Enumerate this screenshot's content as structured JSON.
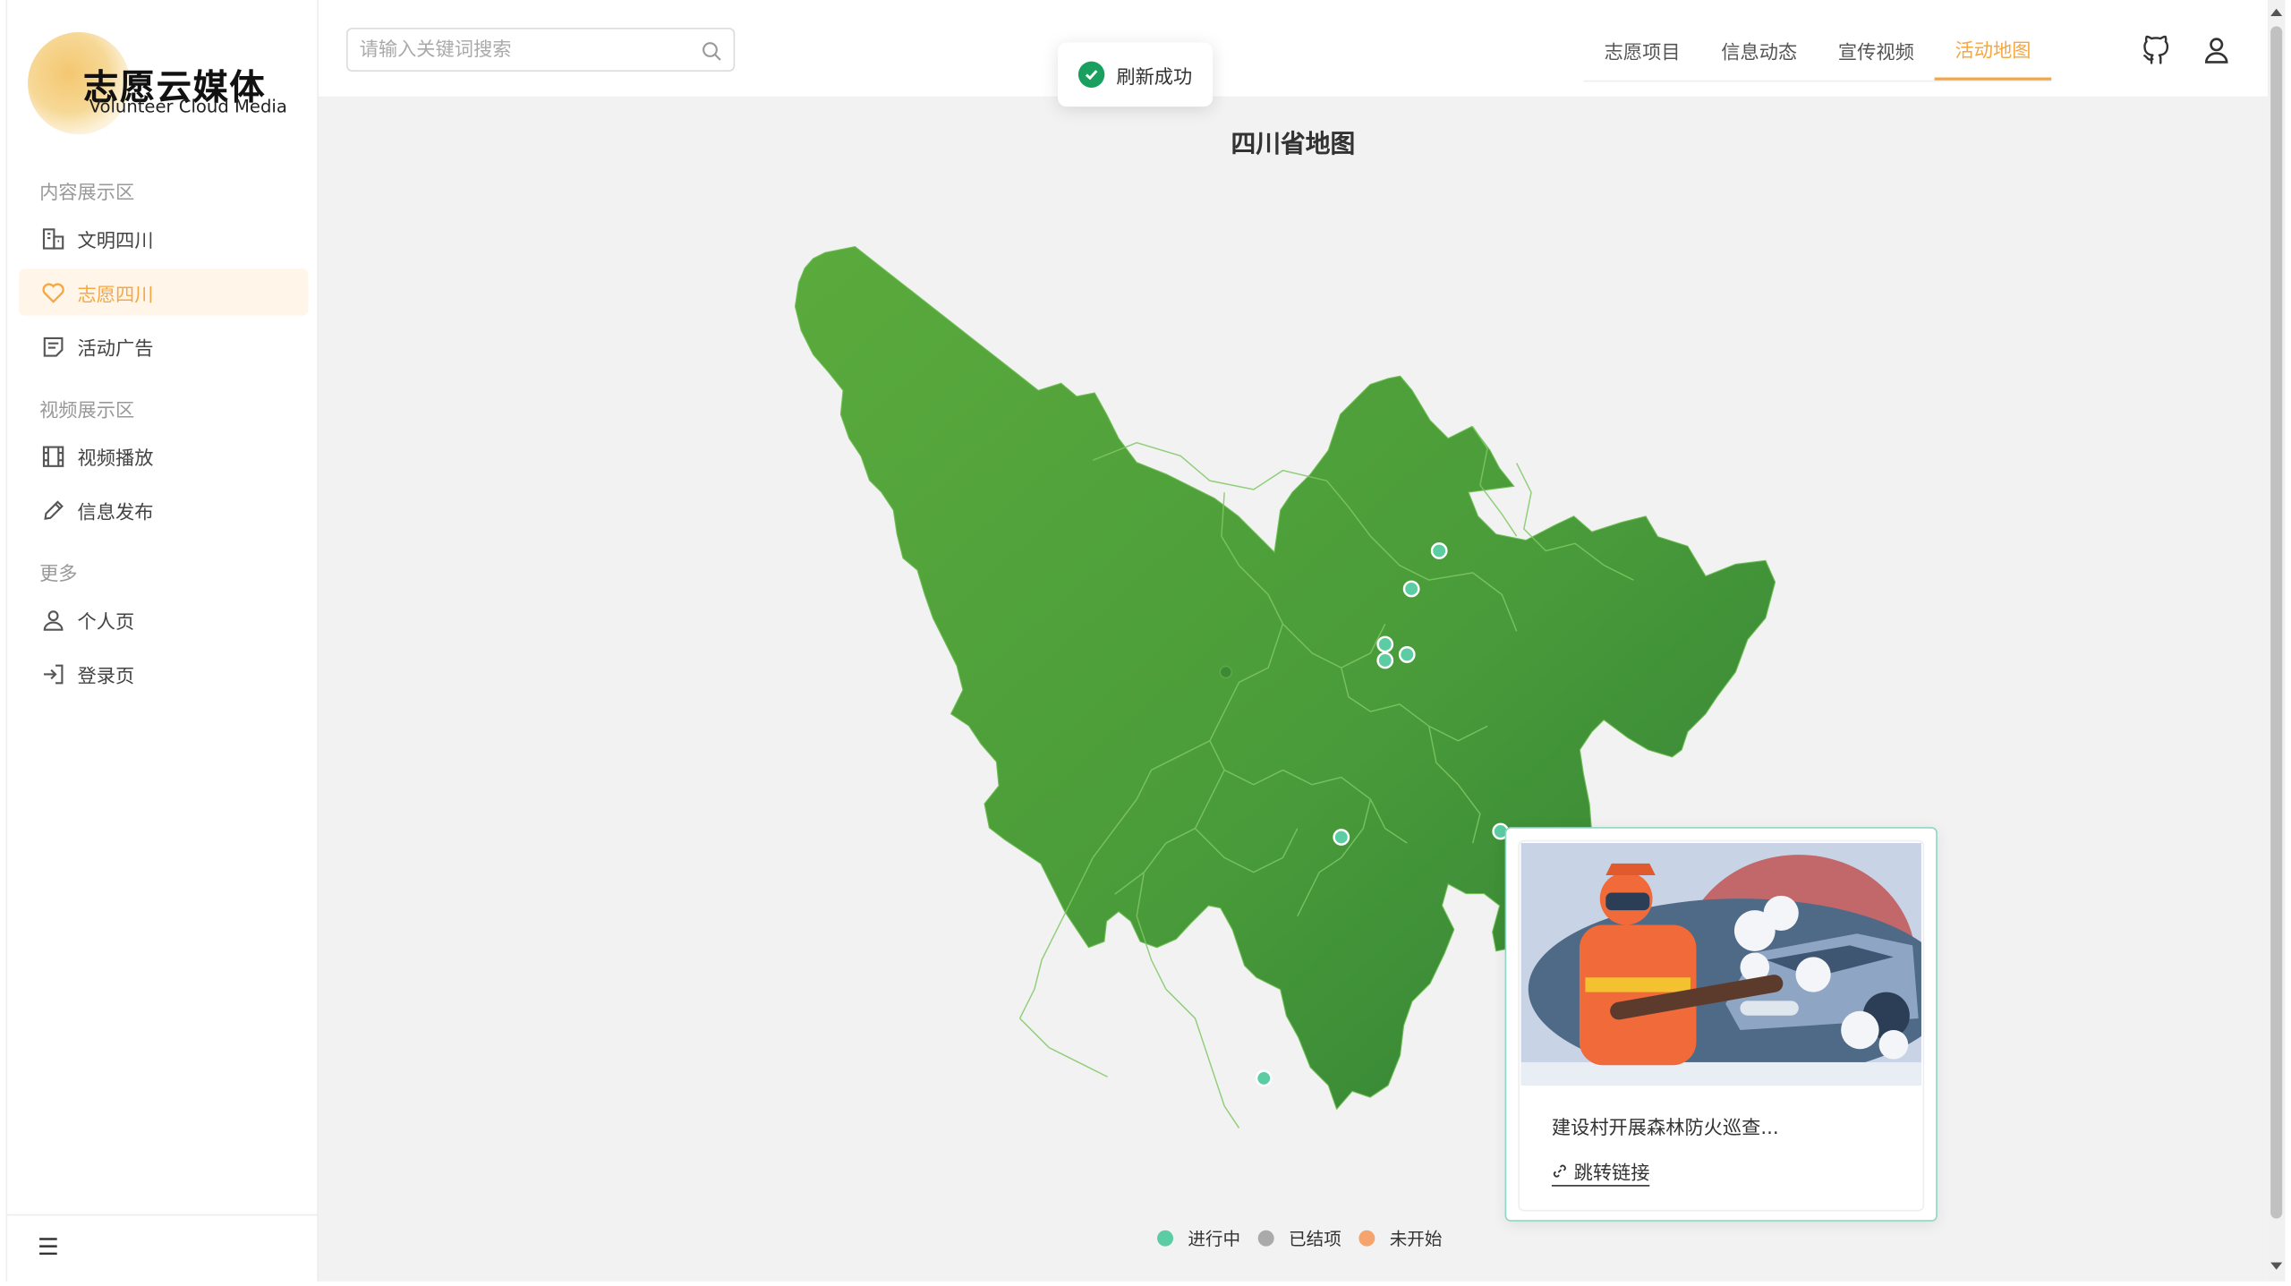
{
  "brand": {
    "title": "志愿云媒体",
    "subtitle": "Volunteer Cloud Media"
  },
  "sidebar": {
    "groups": [
      {
        "label": "内容展示区",
        "items": [
          {
            "label": "文明四川",
            "icon": "building-icon",
            "active": false
          },
          {
            "label": "志愿四川",
            "icon": "heart-icon",
            "active": true
          },
          {
            "label": "活动广告",
            "icon": "document-icon",
            "active": false
          }
        ]
      },
      {
        "label": "视频展示区",
        "items": [
          {
            "label": "视频播放",
            "icon": "film-icon",
            "active": false
          },
          {
            "label": "信息发布",
            "icon": "pencil-icon",
            "active": false
          }
        ]
      },
      {
        "label": "更多",
        "items": [
          {
            "label": "个人页",
            "icon": "user-icon",
            "active": false
          },
          {
            "label": "登录页",
            "icon": "login-icon",
            "active": false
          }
        ]
      }
    ],
    "collapse_icon": "menu-icon"
  },
  "search": {
    "placeholder": "请输入关键词搜索",
    "value": ""
  },
  "tabs": [
    {
      "label": "志愿项目",
      "active": false
    },
    {
      "label": "信息动态",
      "active": false
    },
    {
      "label": "宣传视频",
      "active": false
    },
    {
      "label": "活动地图",
      "active": true
    }
  ],
  "header_icons": [
    "github-icon",
    "user-icon"
  ],
  "toast": {
    "text": "刷新成功",
    "status": "success"
  },
  "map": {
    "title": "四川省地图",
    "fill_color": "#4e9e3a",
    "legend": [
      {
        "label": "进行中",
        "color": "#5ccda3"
      },
      {
        "label": "已结项",
        "color": "#aaaaaa"
      },
      {
        "label": "未开始",
        "color": "#f4a46c"
      }
    ]
  },
  "popup": {
    "title": "建设村开展森林防火巡查...",
    "link_label": "跳转链接",
    "accent": "#8fd6c4"
  },
  "colors": {
    "accent": "#f5a742",
    "active_bg": "#fff5e9"
  }
}
